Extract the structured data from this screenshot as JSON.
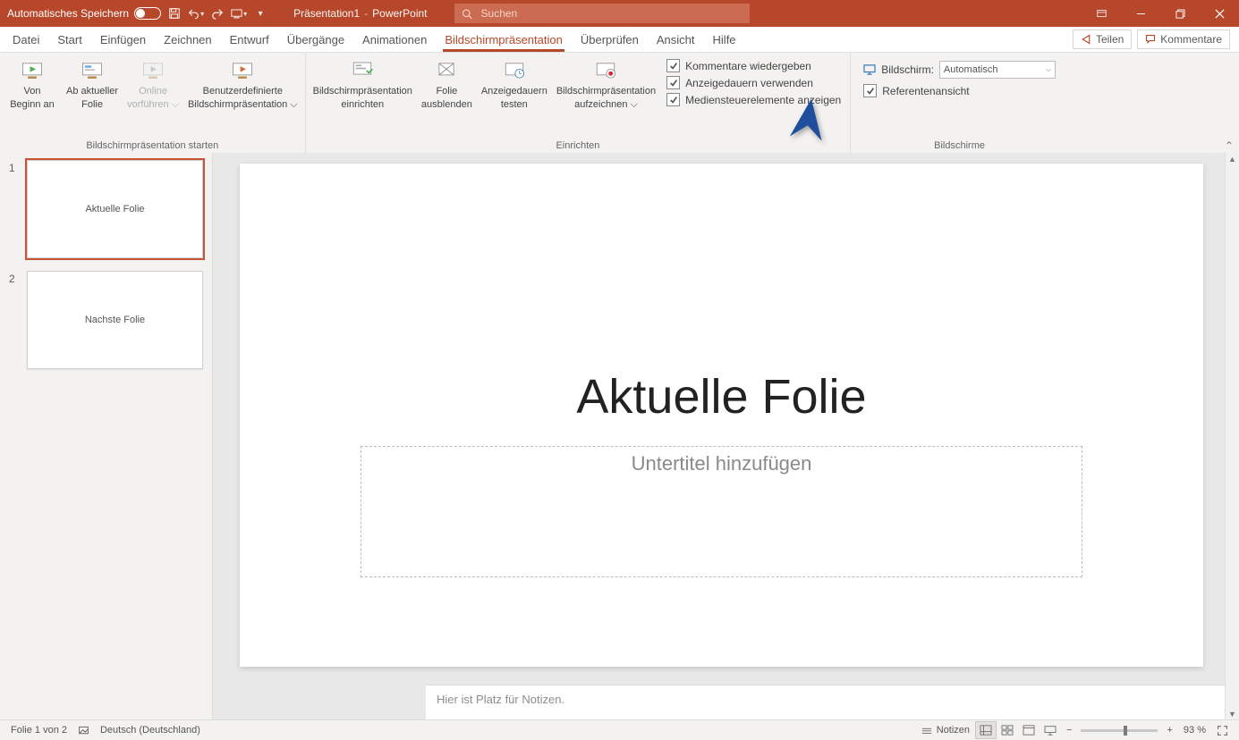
{
  "titlebar": {
    "autosave_label": "Automatisches Speichern",
    "doc_name": "Präsentation1",
    "app_name": "PowerPoint",
    "search_placeholder": "Suchen"
  },
  "menu": {
    "items": [
      "Datei",
      "Start",
      "Einfügen",
      "Zeichnen",
      "Entwurf",
      "Übergänge",
      "Animationen",
      "Bildschirmpräsentation",
      "Überprüfen",
      "Ansicht",
      "Hilfe"
    ],
    "active_index": 7,
    "share": "Teilen",
    "comments": "Kommentare"
  },
  "ribbon": {
    "group1": {
      "label": "Bildschirmpräsentation starten",
      "btns": [
        {
          "l1": "Von",
          "l2": "Beginn an"
        },
        {
          "l1": "Ab aktueller",
          "l2": "Folie"
        },
        {
          "l1": "Online",
          "l2": "vorführen ⌵",
          "disabled": true
        },
        {
          "l1": "Benutzerdefinierte",
          "l2": "Bildschirmpräsentation ⌵"
        }
      ]
    },
    "group2": {
      "label": "Einrichten",
      "btns": [
        {
          "l1": "Bildschirmpräsentation",
          "l2": "einrichten"
        },
        {
          "l1": "Folie",
          "l2": "ausblenden"
        },
        {
          "l1": "Anzeigedauern",
          "l2": "testen"
        },
        {
          "l1": "Bildschirmpräsentation",
          "l2": "aufzeichnen ⌵"
        }
      ],
      "checks": [
        "Kommentare wiedergeben",
        "Anzeigedauern verwenden",
        "Mediensteuerelemente anzeigen"
      ]
    },
    "group3": {
      "label": "Bildschirme",
      "screen_label": "Bildschirm:",
      "screen_value": "Automatisch",
      "presenter_view": "Referentenansicht"
    }
  },
  "thumbs": [
    {
      "n": "1",
      "label": "Aktuelle Folie",
      "selected": true
    },
    {
      "n": "2",
      "label": "Nachste Folie",
      "selected": false
    }
  ],
  "slide": {
    "title": "Aktuelle Folie",
    "subtitle_placeholder": "Untertitel hinzufügen"
  },
  "notes_placeholder": "Hier ist Platz für Notizen.",
  "status": {
    "slide_info": "Folie 1 von 2",
    "language": "Deutsch (Deutschland)",
    "notes_btn": "Notizen",
    "zoom": "93 %"
  }
}
